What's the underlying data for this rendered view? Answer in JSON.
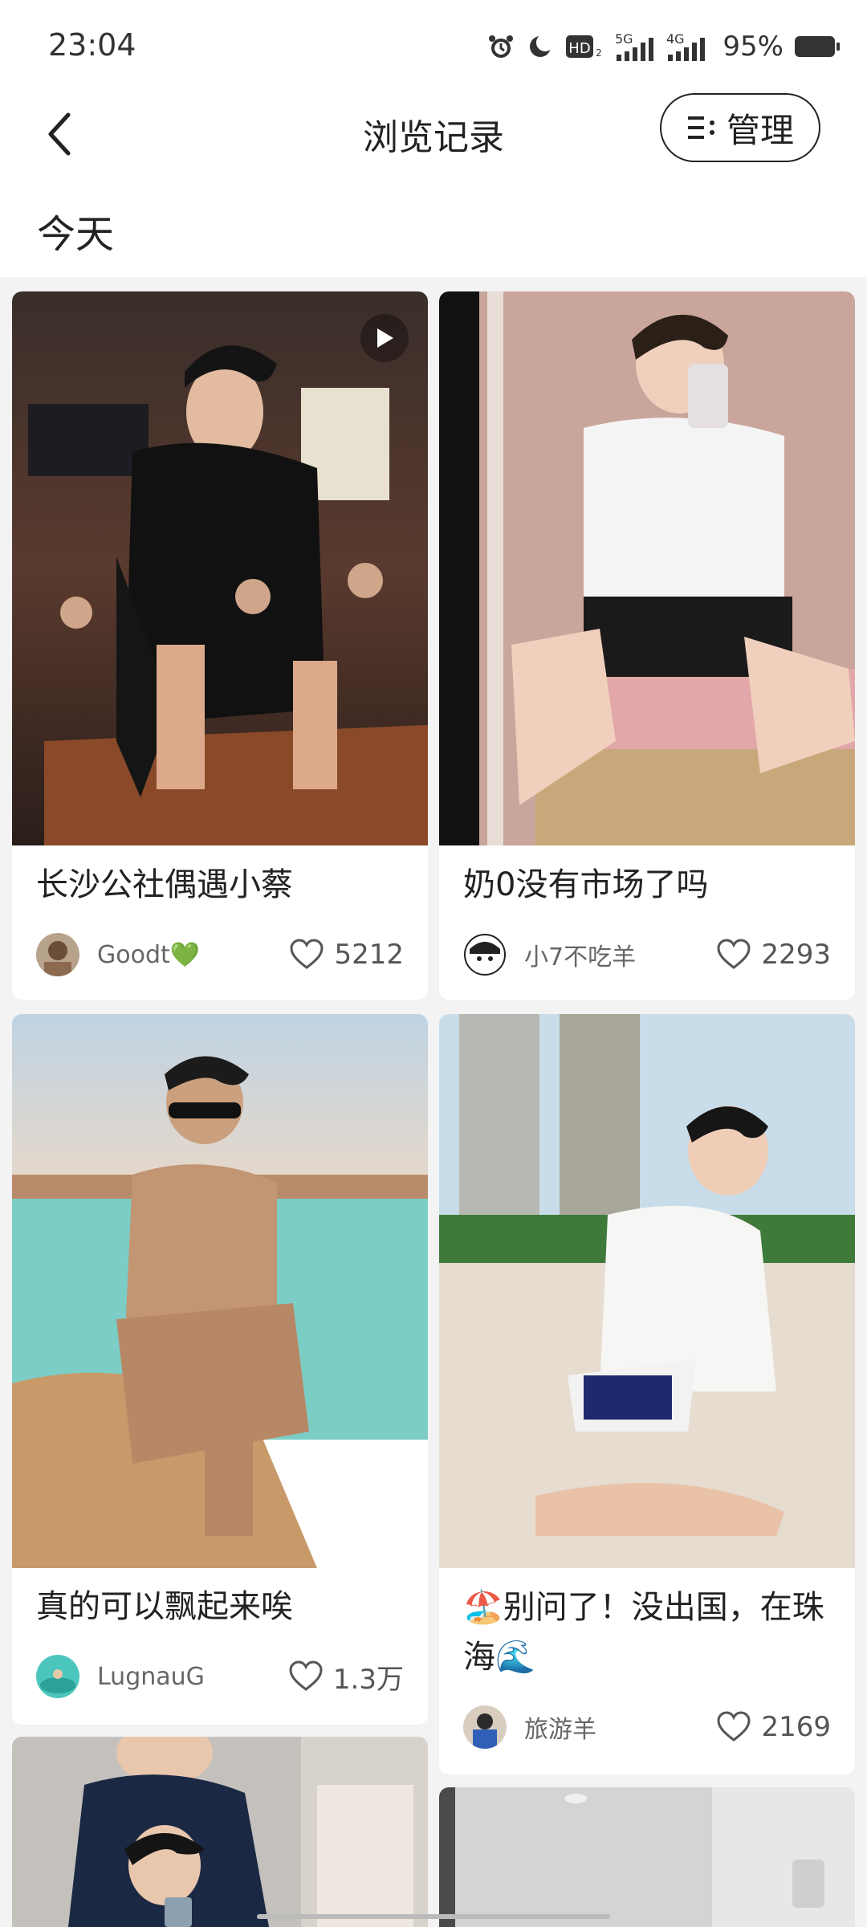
{
  "status_bar": {
    "time": "23:04",
    "battery_percent": "95%",
    "icons": [
      "alarm-icon",
      "moon-icon",
      "hd-icon",
      "5g-signal-icon",
      "4g-signal-icon",
      "battery-icon"
    ],
    "network_5g": "5G",
    "network_4g": "4G",
    "hd": "HD"
  },
  "header": {
    "title": "浏览记录",
    "manage_label": "管理"
  },
  "section": {
    "title": "今天"
  },
  "cards": [
    {
      "title": "长沙公社偶遇小蔡",
      "author": "Goodt💚",
      "likes": "5212",
      "is_video": true
    },
    {
      "title": "奶0没有市场了吗",
      "author": "小7不吃羊",
      "likes": "2293",
      "is_video": false
    },
    {
      "title": "真的可以飘起来唉",
      "author": "LugnauG",
      "likes": "1.3万",
      "is_video": false
    },
    {
      "title": "🏖️别问了！没出国，在珠海🌊",
      "author": "旅游羊",
      "likes": "2169",
      "is_video": false
    }
  ],
  "colors": {
    "background": "#f3f3f3",
    "card": "#ffffff",
    "text": "#222222",
    "muted": "#666666"
  }
}
